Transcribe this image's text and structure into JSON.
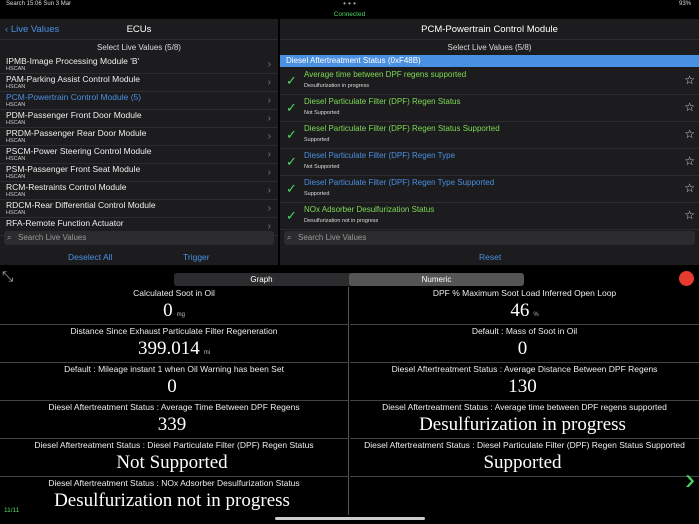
{
  "status_bar": {
    "left": "Search  15:06  Sun 3 Mar",
    "right": "93%",
    "connected": "Connected"
  },
  "left_pane": {
    "back_label": "Live Values",
    "title": "ECUs",
    "subtitle": "Select Live Values (5/8)",
    "ecus": [
      {
        "name": "IPMB-Image Processing Module 'B'",
        "bus": "HSCAN"
      },
      {
        "name": "PAM-Parking Assist Control Module",
        "bus": "HSCAN"
      },
      {
        "name": "PCM-Powertrain Control Module (5)",
        "bus": "HSCAN"
      },
      {
        "name": "PDM-Passenger Front Door Module",
        "bus": "HSCAN"
      },
      {
        "name": "PRDM-Passenger Rear Door Module",
        "bus": "HSCAN"
      },
      {
        "name": "PSCM-Power Steering Control Module",
        "bus": "HSCAN"
      },
      {
        "name": "PSM-Passenger Front Seat Module",
        "bus": "HSCAN"
      },
      {
        "name": "RCM-Restraints Control Module",
        "bus": "HSCAN"
      },
      {
        "name": "RDCM-Rear Differential Control Module",
        "bus": "HSCAN"
      },
      {
        "name": "RFA-Remote Function Actuator",
        "bus": ""
      }
    ],
    "search_placeholder": "Search Live Values",
    "deselect_label": "Deselect All",
    "trigger_label": "Trigger"
  },
  "right_pane": {
    "title": "PCM-Powertrain Control Module",
    "subtitle": "Select Live Values (5/8)",
    "section": "Diesel Aftertreatment Status (0xF48B)",
    "pids": [
      {
        "name": "Average time between DPF regens supported",
        "value": "Desulfurization in progress",
        "color": "#7ed957"
      },
      {
        "name": "Diesel Particulate Filter (DPF) Regen Status",
        "value": "Not Supported",
        "color": "#7ed957"
      },
      {
        "name": "Diesel Particulate Filter (DPF) Regen Status Supported",
        "value": "Supported",
        "color": "#7ed957"
      },
      {
        "name": "Diesel Particulate Filter (DPF) Regen Type",
        "value": "Not Supported",
        "color": "#4a90e2"
      },
      {
        "name": "Diesel Particulate Filter (DPF) Regen Type Supported",
        "value": "Supported",
        "color": "#4a90e2"
      },
      {
        "name": "NOx Adsorber Desulfurization Status",
        "value": "Desulfurization not in progress",
        "color": "#7ed957"
      }
    ],
    "search_placeholder": "Search Live Values",
    "reset_label": "Reset"
  },
  "viewer": {
    "tabs": [
      "Graph",
      "Numeric"
    ],
    "selected_tab": "Numeric",
    "cells": [
      {
        "label": "Calculated Soot in Oil",
        "value": "0",
        "unit": "mg"
      },
      {
        "label": "DPF % Maximum Soot Load Inferred Open Loop",
        "value": "46",
        "unit": "%"
      },
      {
        "label": "Distance Since Exhaust Particulate Filter Regeneration",
        "value": "399.014",
        "unit": "mi"
      },
      {
        "label": "Default : Mass of Soot in Oil",
        "value": "0",
        "unit": ""
      },
      {
        "label": "Default : Mileage instant 1 when Oil Warning has been Set",
        "value": "0",
        "unit": ""
      },
      {
        "label": "Diesel Aftertreatment Status : Average Distance Between DPF Regens",
        "value": "130",
        "unit": ""
      },
      {
        "label": "Diesel Aftertreatment Status : Average Time Between DPF Regens",
        "value": "339",
        "unit": ""
      },
      {
        "label": "Diesel Aftertreatment Status : Average time between DPF regens supported",
        "value": "Desulfurization in progress",
        "unit": ""
      },
      {
        "label": "Diesel Aftertreatment Status : Diesel Particulate Filter (DPF) Regen Status",
        "value": "Not Supported",
        "unit": ""
      },
      {
        "label": "Diesel Aftertreatment Status : Diesel Particulate Filter (DPF) Regen Status Supported",
        "value": "Supported",
        "unit": ""
      },
      {
        "label": "Diesel Aftertreatment Status : NOx Adsorber Desulfurization Status",
        "value": "Desulfurization not in progress",
        "unit": ""
      },
      {
        "label": "",
        "value": "",
        "unit": ""
      }
    ],
    "pager": "11/11"
  }
}
